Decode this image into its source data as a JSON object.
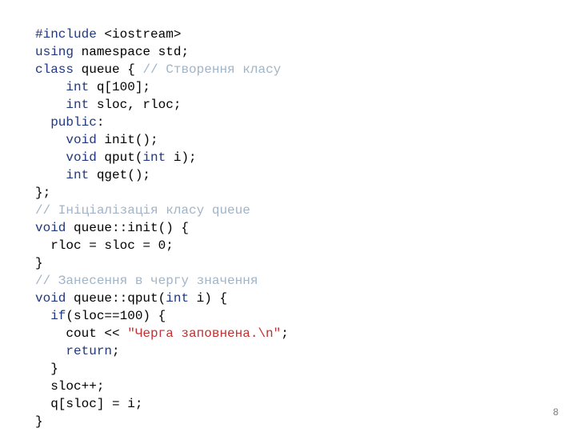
{
  "code": {
    "l1a": "#include ",
    "l1b": "<iostream>",
    "l2a": "using",
    "l2b": " namespace std;",
    "l3a": "class",
    "l3b": " queue { ",
    "l3c": "// Створення класу",
    "l4a": "    int",
    "l4b": " q[100];",
    "l5a": "    int",
    "l5b": " sloc, rloc;",
    "l6a": "  public",
    "l6b": ":",
    "l7a": "    void",
    "l7b": " init();",
    "l8a": "    void",
    "l8b": " qput(",
    "l8c": "int",
    "l8d": " i);",
    "l9a": "    int",
    "l9b": " qget();",
    "l10": "};",
    "l11": "// Ініціалізація класу queue",
    "l12a": "void",
    "l12b": " queue::init() {",
    "l13": "  rloc = sloc = 0;",
    "l14": "}",
    "l15": "// Занесення в чергу значення",
    "l16a": "void",
    "l16b": " queue::qput(",
    "l16c": "int",
    "l16d": " i) {",
    "l17a": "  if",
    "l17b": "(sloc==100) {",
    "l18a": "    cout << ",
    "l18b": "\"Черга заповнена.\\n\"",
    "l18c": ";",
    "l19a": "    return",
    "l19b": ";",
    "l20": "  }",
    "l21": "  sloc++;",
    "l22": "  q[sloc] = i;",
    "l23": "}"
  },
  "page_number": "8"
}
